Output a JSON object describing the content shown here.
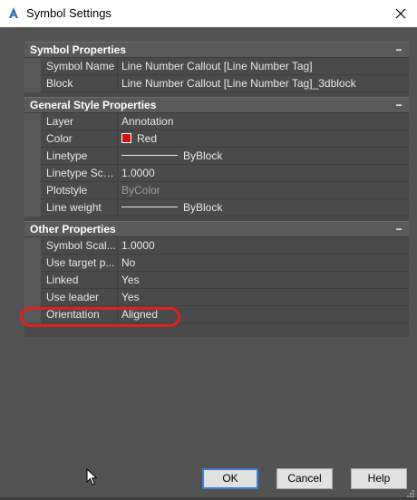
{
  "window": {
    "title": "Symbol Settings"
  },
  "sections": {
    "symbol_properties": {
      "title": "Symbol Properties",
      "rows": [
        {
          "label": "Symbol Name",
          "value": "Line Number Callout [Line Number Tag]"
        },
        {
          "label": "Block",
          "value": "Line Number Callout [Line Number Tag]_3dblock"
        }
      ]
    },
    "general_style": {
      "title": "General Style Properties",
      "rows": [
        {
          "label": "Layer",
          "value": "Annotation"
        },
        {
          "label": "Color",
          "value": "Red"
        },
        {
          "label": "Linetype",
          "value": "ByBlock"
        },
        {
          "label": "Linetype Scale",
          "value": "1.0000"
        },
        {
          "label": "Plotstyle",
          "value": "ByColor"
        },
        {
          "label": "Line weight",
          "value": "ByBlock"
        }
      ]
    },
    "other_properties": {
      "title": "Other Properties",
      "rows": [
        {
          "label": "Symbol Scal...",
          "value": "1.0000"
        },
        {
          "label": "Use target p...",
          "value": "No"
        },
        {
          "label": "Linked",
          "value": "Yes"
        },
        {
          "label": "Use leader",
          "value": "Yes"
        },
        {
          "label": "Orientation",
          "value": "Aligned"
        }
      ]
    }
  },
  "collapse_glyph": "−",
  "buttons": {
    "ok": "OK",
    "cancel": "Cancel",
    "help": "Help"
  },
  "colors": {
    "swatch_red": "#d11111",
    "highlight": "#e01f1f",
    "accent": "#3c7fd3"
  },
  "icons": {
    "app": "autocad-a-icon",
    "close": "close-icon"
  }
}
